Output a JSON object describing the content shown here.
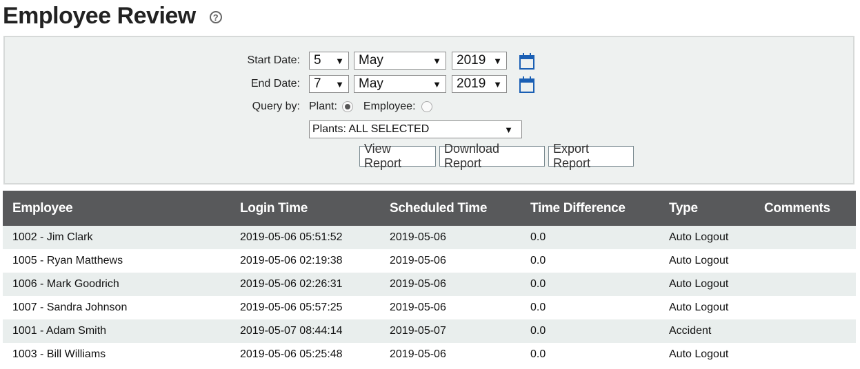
{
  "page": {
    "title": "Employee Review",
    "help_icon": "question-circle-icon"
  },
  "filters": {
    "start_date_label": "Start Date:",
    "start_day": "5",
    "start_month": "May",
    "start_year": "2019",
    "end_date_label": "End Date:",
    "end_day": "7",
    "end_month": "May",
    "end_year": "2019",
    "query_by_label": "Query by:",
    "plant_label": "Plant:",
    "employee_label": "Employee:",
    "query_by_selected": "Plant",
    "plants_select": "Plants: ALL SELECTED",
    "calendar_icon": "calendar-icon",
    "accent_color": "#1a5fb4"
  },
  "buttons": {
    "view": "View Report",
    "download": "Download Report",
    "export": "Export Report"
  },
  "table": {
    "headers": {
      "employee": "Employee",
      "login_time": "Login Time",
      "scheduled_time": "Scheduled Time",
      "time_difference": "Time Difference",
      "type": "Type",
      "comments": "Comments"
    },
    "header_bg": "#58595b",
    "rows": [
      {
        "employee": "1002 - Jim Clark",
        "login_time": "2019-05-06 05:51:52",
        "scheduled_time": "2019-05-06",
        "time_difference": "0.0",
        "type": "Auto Logout",
        "comments": ""
      },
      {
        "employee": "1005 - Ryan Matthews",
        "login_time": "2019-05-06 02:19:38",
        "scheduled_time": "2019-05-06",
        "time_difference": "0.0",
        "type": "Auto Logout",
        "comments": ""
      },
      {
        "employee": "1006 - Mark Goodrich",
        "login_time": "2019-05-06 02:26:31",
        "scheduled_time": "2019-05-06",
        "time_difference": "0.0",
        "type": "Auto Logout",
        "comments": ""
      },
      {
        "employee": "1007 - Sandra Johnson",
        "login_time": "2019-05-06 05:57:25",
        "scheduled_time": "2019-05-06",
        "time_difference": "0.0",
        "type": "Auto Logout",
        "comments": ""
      },
      {
        "employee": "1001 - Adam Smith",
        "login_time": "2019-05-07 08:44:14",
        "scheduled_time": "2019-05-07",
        "time_difference": "0.0",
        "type": "Accident",
        "comments": ""
      },
      {
        "employee": "1003 - Bill Williams",
        "login_time": "2019-05-06 05:25:48",
        "scheduled_time": "2019-05-06",
        "time_difference": "0.0",
        "type": "Auto Logout",
        "comments": ""
      }
    ]
  }
}
